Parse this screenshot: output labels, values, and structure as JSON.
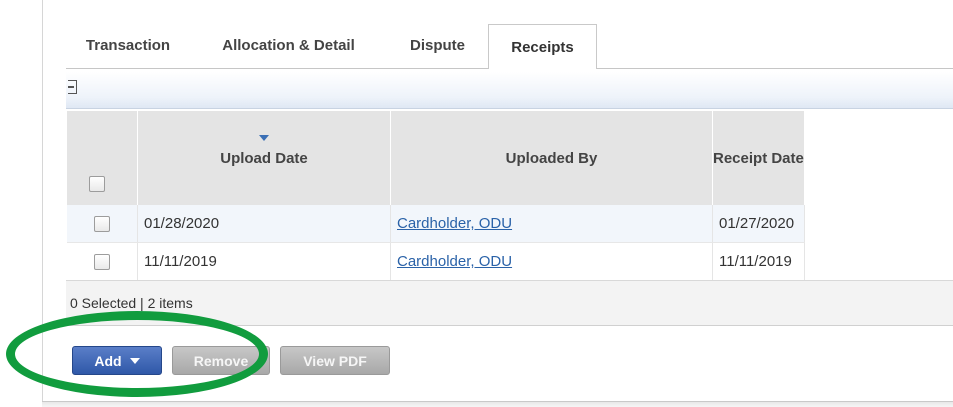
{
  "tabs": [
    {
      "label": "Transaction",
      "active": false
    },
    {
      "label": "Allocation & Detail",
      "active": false
    },
    {
      "label": "Dispute",
      "active": false
    },
    {
      "label": "Receipts",
      "active": true
    }
  ],
  "table": {
    "columns": [
      "Upload Date",
      "Uploaded By",
      "Receipt Date"
    ],
    "sorted_column": "Upload Date",
    "rows": [
      {
        "upload_date": "01/28/2020",
        "uploaded_by": "Cardholder, ODU",
        "receipt_date": "01/27/2020"
      },
      {
        "upload_date": "11/11/2019",
        "uploaded_by": "Cardholder, ODU",
        "receipt_date": "11/11/2019"
      }
    ]
  },
  "status": {
    "text": "0 Selected | 2 items"
  },
  "buttons": {
    "add": "Add",
    "remove": "Remove",
    "view_pdf": "View PDF"
  },
  "icons": {
    "collapse": "collapse-icon",
    "sort": "sort-desc-icon",
    "caret": "caret-down-icon"
  },
  "colors": {
    "accent": "#2f58a8",
    "link": "#2a62a8",
    "highlight": "#119c3e"
  }
}
